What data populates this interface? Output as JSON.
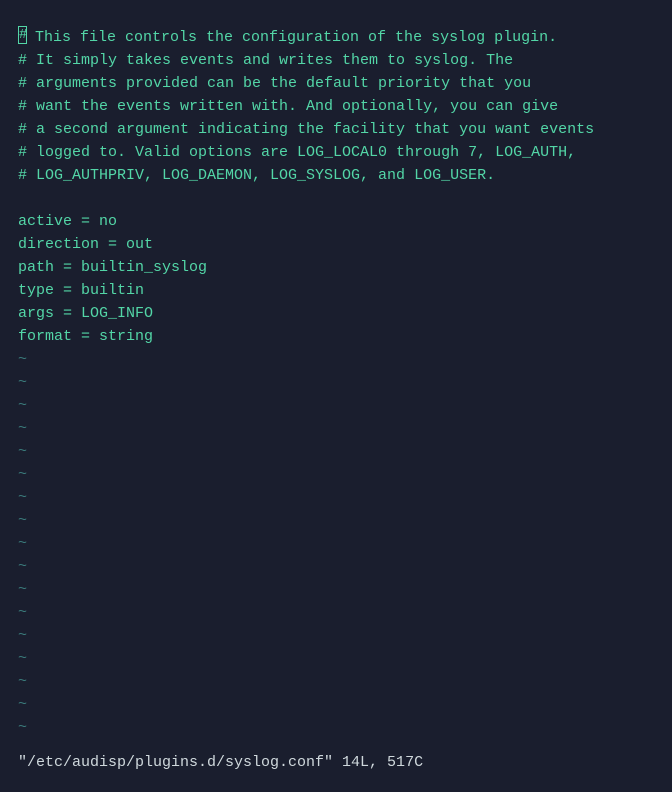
{
  "lines": {
    "l1_before_cursor": "",
    "l1_after_cursor": " This file controls the configuration of the syslog plugin.",
    "l2": "# It simply takes events and writes them to syslog. The",
    "l3": "# arguments provided can be the default priority that you",
    "l4": "# want the events written with. And optionally, you can give",
    "l5": "# a second argument indicating the facility that you want events",
    "l6": "# logged to. Valid options are LOG_LOCAL0 through 7, LOG_AUTH,",
    "l7": "# LOG_AUTHPRIV, LOG_DAEMON, LOG_SYSLOG, and LOG_USER.",
    "l8": "",
    "l9": "active = no",
    "l10": "direction = out",
    "l11": "path = builtin_syslog",
    "l12": "type = builtin",
    "l13": "args = LOG_INFO",
    "l14": "format = string"
  },
  "cursor_char": "#",
  "tilde": "~",
  "status": "\"/etc/audisp/plugins.d/syslog.conf\" 14L, 517C"
}
